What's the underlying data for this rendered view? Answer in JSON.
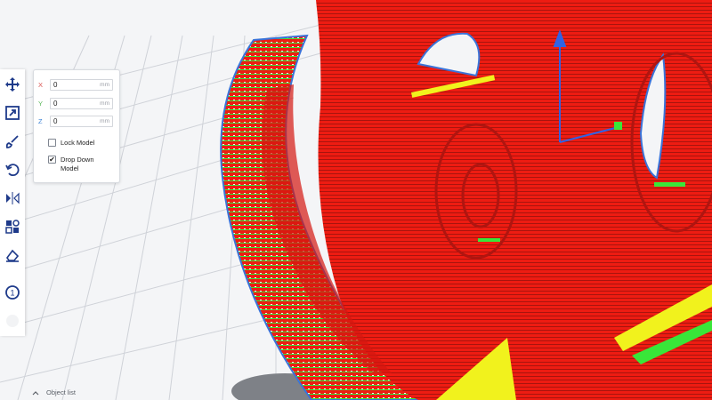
{
  "toolbar": {
    "tools": [
      {
        "name": "move-tool",
        "icon": "move-arrows-icon",
        "active": true
      },
      {
        "name": "scale-tool",
        "icon": "scale-box-icon",
        "active": false
      },
      {
        "name": "rotate-tool",
        "icon": "rotate-icon",
        "active": false
      },
      {
        "name": "mirror-tool",
        "icon": "mirror-icon",
        "active": false
      },
      {
        "name": "per-model-settings-tool",
        "icon": "grid-settings-icon",
        "active": false
      },
      {
        "name": "support-blocker-tool",
        "icon": "eraser-icon",
        "active": false
      },
      {
        "name": "extruder-1-button",
        "icon": "extruder-number-icon",
        "label": "1"
      },
      {
        "name": "extruder-2-button",
        "icon": "extruder-disabled-icon",
        "label": ""
      }
    ]
  },
  "move_panel": {
    "x": {
      "axis": "X",
      "value": "0",
      "unit": "mm",
      "axis_color": "#d9534f"
    },
    "y": {
      "axis": "Y",
      "value": "0",
      "unit": "mm",
      "axis_color": "#5cb85c"
    },
    "z": {
      "axis": "Z",
      "value": "0",
      "unit": "mm",
      "axis_color": "#3b82d6"
    },
    "lock_model": {
      "label": "Lock Model",
      "checked": false
    },
    "drop_down": {
      "label": "Drop Down Model",
      "checked": true
    }
  },
  "footer": {
    "object_list_label": "Object list"
  },
  "colors": {
    "wall_red": "#ee1c12",
    "infill_green": "#39e639",
    "skin_yellow": "#f1f21d",
    "gizmo_blue": "#2f63e6",
    "outline_blue": "#3a73d9"
  }
}
